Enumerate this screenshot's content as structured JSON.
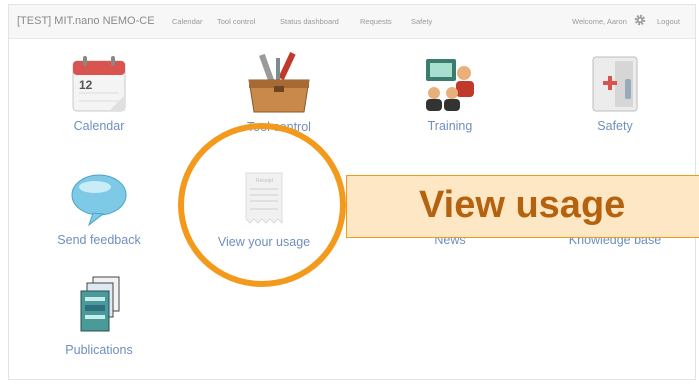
{
  "navbar": {
    "brand": "[TEST] MIT.nano NEMO-CE",
    "links": [
      "Calendar",
      "Tool control",
      "Status dashboard",
      "Requests",
      "Safety"
    ],
    "welcome": "Welcome, Aaron",
    "logout": "Logout",
    "gear_icon": "gear-icon"
  },
  "tiles": [
    {
      "label": "Calendar",
      "icon": "calendar-icon",
      "day": "12"
    },
    {
      "label": "Tool control",
      "icon": "toolbox-icon"
    },
    {
      "label": "Training",
      "icon": "training-icon"
    },
    {
      "label": "Safety",
      "icon": "first-aid-icon"
    },
    {
      "label": "Send feedback",
      "icon": "speech-bubble-icon"
    },
    {
      "label": "View your usage",
      "icon": "receipt-icon",
      "receipt_title": "Receipt"
    },
    {
      "label": "News",
      "icon": "news-icon"
    },
    {
      "label": "Knowledge base",
      "icon": "book-icon"
    },
    {
      "label": "Publications",
      "icon": "publications-icon"
    }
  ],
  "overlay": {
    "text": "View usage",
    "accent_color": "#f39a1c",
    "banner_color": "#fde7c5"
  }
}
